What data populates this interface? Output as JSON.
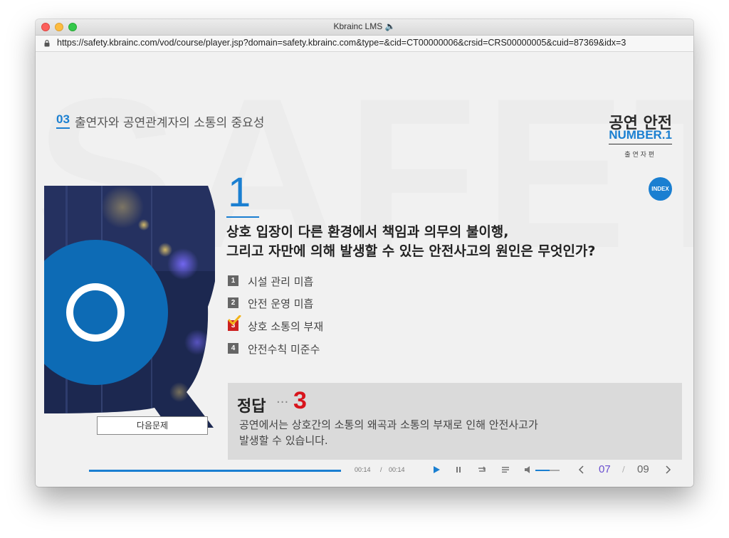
{
  "window": {
    "title": "Kbrainc LMS 🔈",
    "url": "https://safety.kbrainc.com/vod/course/player.jsp?domain=safety.kbrainc.com&type=&cid=CT00000006&crsid=CRS00000005&cuid=87369&idx=3"
  },
  "header": {
    "section_number": "03",
    "section_title": "출연자와 공연관계자의 소통의 중요성",
    "brand_title": "공연 안전",
    "brand_sub": "NUMBER.1",
    "brand_caption": "출 연 자 편",
    "index_label": "INDEX"
  },
  "quiz": {
    "number": "1",
    "question_line1": "상호 입장이 다른 환경에서 책임과 의무의 불이행,",
    "question_line2": "그리고 자만에 의해 발생할 수 있는 안전사고의 원인은 무엇인가?",
    "options": [
      {
        "num": "1",
        "label": "시설 관리 미흡",
        "checked": false
      },
      {
        "num": "2",
        "label": "안전 운영 미흡",
        "checked": false
      },
      {
        "num": "3",
        "label": "상호 소통의 부재",
        "checked": true
      },
      {
        "num": "4",
        "label": "안전수칙 미준수",
        "checked": false
      }
    ],
    "next_label": "다음문제",
    "answer_label": "정답",
    "answer_dots": "···",
    "answer_number": "3",
    "answer_line1": "공연에서는 상호간의 소통의 왜곡과 소통의 부재로 인해 안전사고가",
    "answer_line2": "발생할 수 있습니다."
  },
  "player": {
    "progress": 1.0,
    "time_current": "00:14",
    "time_sep": "/",
    "time_total": "00:14",
    "volume": 0.6,
    "page_current": "07",
    "page_sep": "/",
    "page_total": "09",
    "accent_color": "#1a7fd1"
  }
}
